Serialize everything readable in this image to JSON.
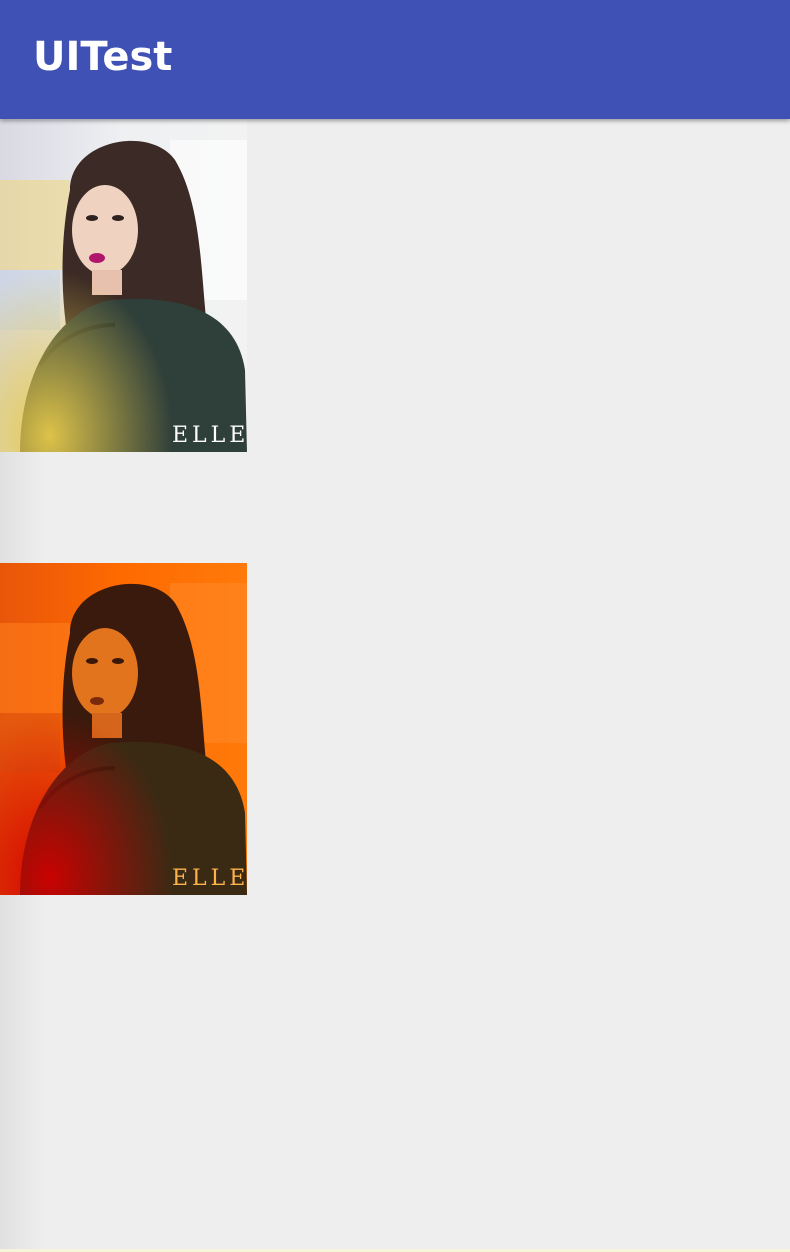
{
  "app_bar": {
    "title": "UITest",
    "color": "#3f51b5"
  },
  "images": [
    {
      "name": "original-photo",
      "filter": "none",
      "watermark": "ELLE"
    },
    {
      "name": "orange-filtered-photo",
      "filter": "orange-tint",
      "watermark": "ELLE"
    }
  ],
  "colors": {
    "background": "#eeeeee",
    "accent": "#3f51b5"
  }
}
